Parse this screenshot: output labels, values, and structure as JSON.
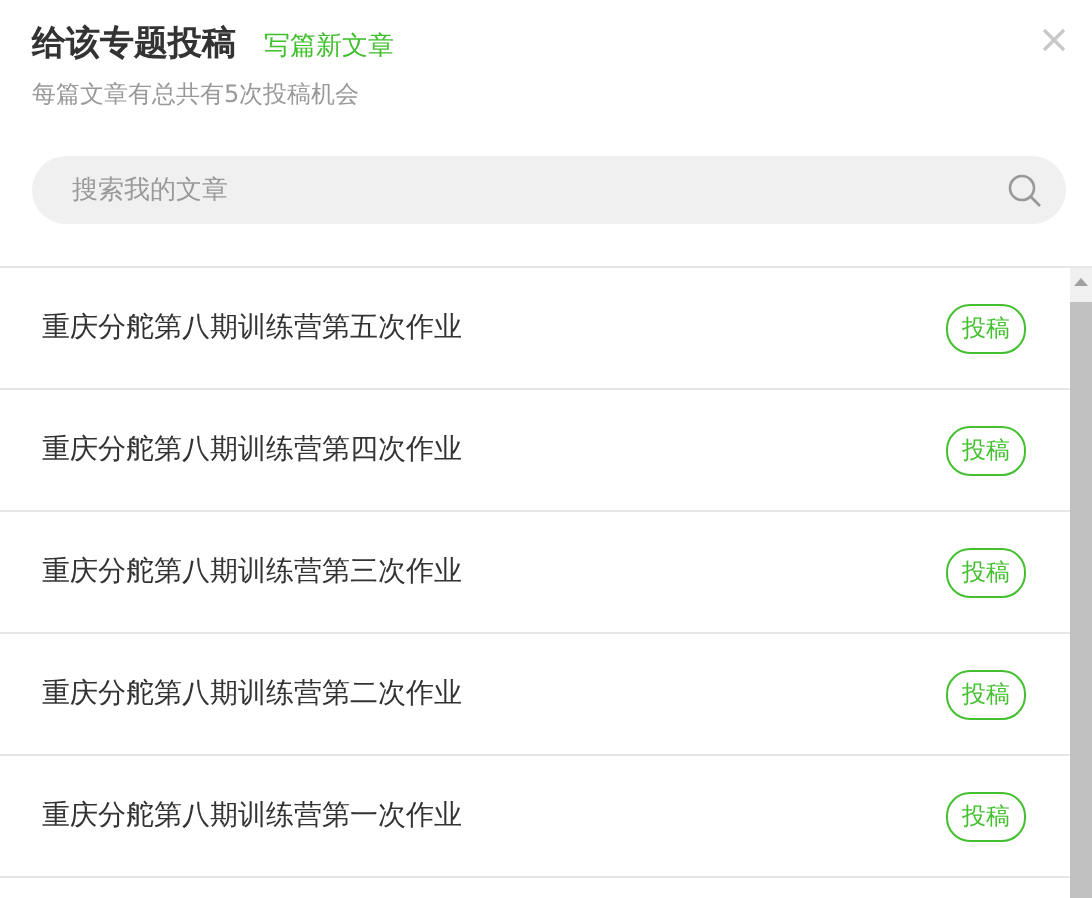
{
  "dialog": {
    "title": "给该专题投稿",
    "write_link": "写篇新文章",
    "subtitle": "每篇文章有总共有5次投稿机会"
  },
  "search": {
    "placeholder": "搜索我的文章"
  },
  "articles": [
    {
      "title": "重庆分舵第八期训练营第五次作业",
      "action": "投稿"
    },
    {
      "title": "重庆分舵第八期训练营第四次作业",
      "action": "投稿"
    },
    {
      "title": "重庆分舵第八期训练营第三次作业",
      "action": "投稿"
    },
    {
      "title": "重庆分舵第八期训练营第二次作业",
      "action": "投稿"
    },
    {
      "title": "重庆分舵第八期训练营第一次作业",
      "action": "投稿"
    }
  ]
}
